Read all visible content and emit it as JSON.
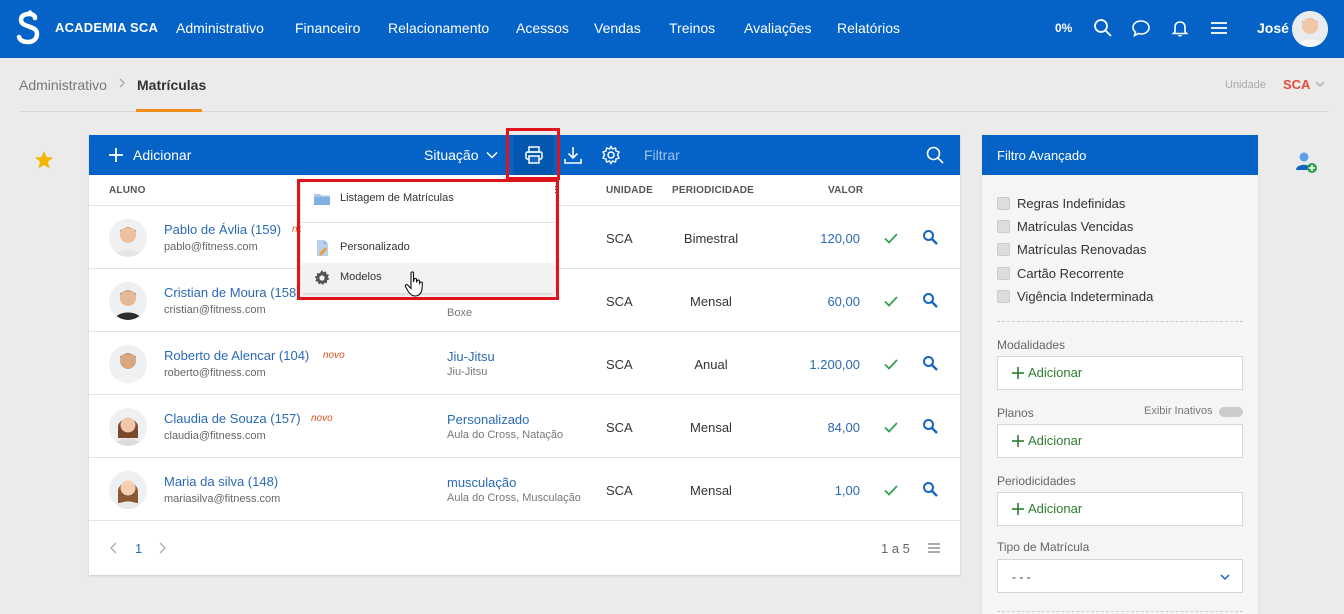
{
  "app": {
    "brand": "ACADEMIA SCA"
  },
  "nav": {
    "items": [
      "Administrativo",
      "Financeiro",
      "Relacionamento",
      "Acessos",
      "Vendas",
      "Treinos",
      "Avaliações",
      "Relatórios"
    ],
    "percent": "0%",
    "user_name": "José"
  },
  "breadcrumb": {
    "parent": "Administrativo",
    "current": "Matrículas"
  },
  "unit": {
    "label": "Unidade",
    "value": "SCA"
  },
  "table": {
    "add_label": "Adicionar",
    "situation_label": "Situação",
    "filter_placeholder": "Filtrar",
    "columns": {
      "aluno": "ALUNO",
      "modalidade_tail": "E",
      "unidade": "UNIDADE",
      "periodicidade": "PERIODICIDADE",
      "valor": "VALOR"
    },
    "rows": [
      {
        "name": "Pablo de Ávlia (159)",
        "novo": "no",
        "email": "pablo@fitness.com",
        "mod": "",
        "mod_sub": "",
        "unit": "SCA",
        "period": "Bimestral",
        "value": "120,00"
      },
      {
        "name": "Cristian de Moura (158)",
        "novo": "",
        "email": "cristian@fitness.com",
        "mod": "",
        "mod_sub": "Boxe",
        "unit": "SCA",
        "period": "Mensal",
        "value": "60,00"
      },
      {
        "name": "Roberto de Alencar (104)",
        "novo": "novo",
        "email": "roberto@fitness.com",
        "mod": "Jiu-Jitsu",
        "mod_sub": "Jiu-Jitsu",
        "unit": "SCA",
        "period": "Anual",
        "value": "1.200,00"
      },
      {
        "name": "Claudia de Souza (157)",
        "novo": "novo",
        "email": "claudia@fitness.com",
        "mod": "Personalizado",
        "mod_sub": "Aula do Cross, Natação",
        "unit": "SCA",
        "period": "Mensal",
        "value": "84,00"
      },
      {
        "name": "Maria da silva (148)",
        "novo": "",
        "email": "mariasilva@fitness.com",
        "mod": "musculação",
        "mod_sub": "Aula do Cross, Musculação",
        "unit": "SCA",
        "period": "Mensal",
        "value": "1,00"
      }
    ],
    "pagination": {
      "page": "1",
      "range": "1 a 5"
    }
  },
  "print_menu": {
    "items": [
      {
        "label": "Listagem de Matrículas",
        "icon": "folder-icon"
      },
      {
        "label": "Personalizado",
        "icon": "document-icon"
      },
      {
        "label": "Modelos",
        "icon": "gear-icon"
      }
    ]
  },
  "filter_panel": {
    "title": "Filtro Avançado",
    "checks": [
      "Regras Indefinidas",
      "Matrículas Vencidas",
      "Matrículas Renovadas",
      "Cartão Recorrente",
      "Vigência Indeterminada"
    ],
    "modalidades_label": "Modalidades",
    "planos_label": "Planos",
    "exibir_inativos": "Exibir Inativos",
    "periodicidades_label": "Periodicidades",
    "add_label": "Adicionar",
    "tipo_label": "Tipo de Matrícula",
    "tipo_value": "- - -"
  },
  "colors": {
    "primary": "#0563c8",
    "accent": "#f28a1a",
    "link": "#2a6ab5",
    "highlight": "#e0141b",
    "novo": "#d9541e"
  }
}
